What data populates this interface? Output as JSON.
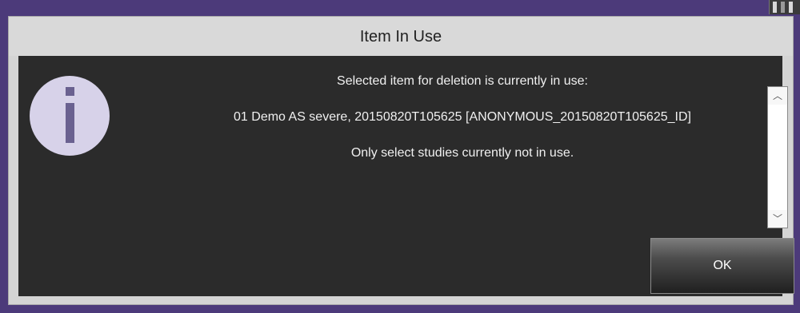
{
  "dialog": {
    "title": "Item In Use",
    "icon": "info-icon",
    "message_lines": [
      "Selected item for deletion is currently in use:",
      "01 Demo AS severe, 20150820T105625 [ANONYMOUS_20150820T105625_ID]",
      "Only select studies currently not in use."
    ],
    "ok_label": "OK"
  },
  "scrollbar": {
    "up_icon": "chevron-up-icon",
    "down_icon": "chevron-down-icon"
  },
  "colors": {
    "background_accent": "#4c3a7a",
    "titlebar": "#d9d9d9",
    "content_background": "#2b2b2b",
    "icon_circle": "#d7d2e9",
    "icon_glyph": "#6a6190"
  }
}
